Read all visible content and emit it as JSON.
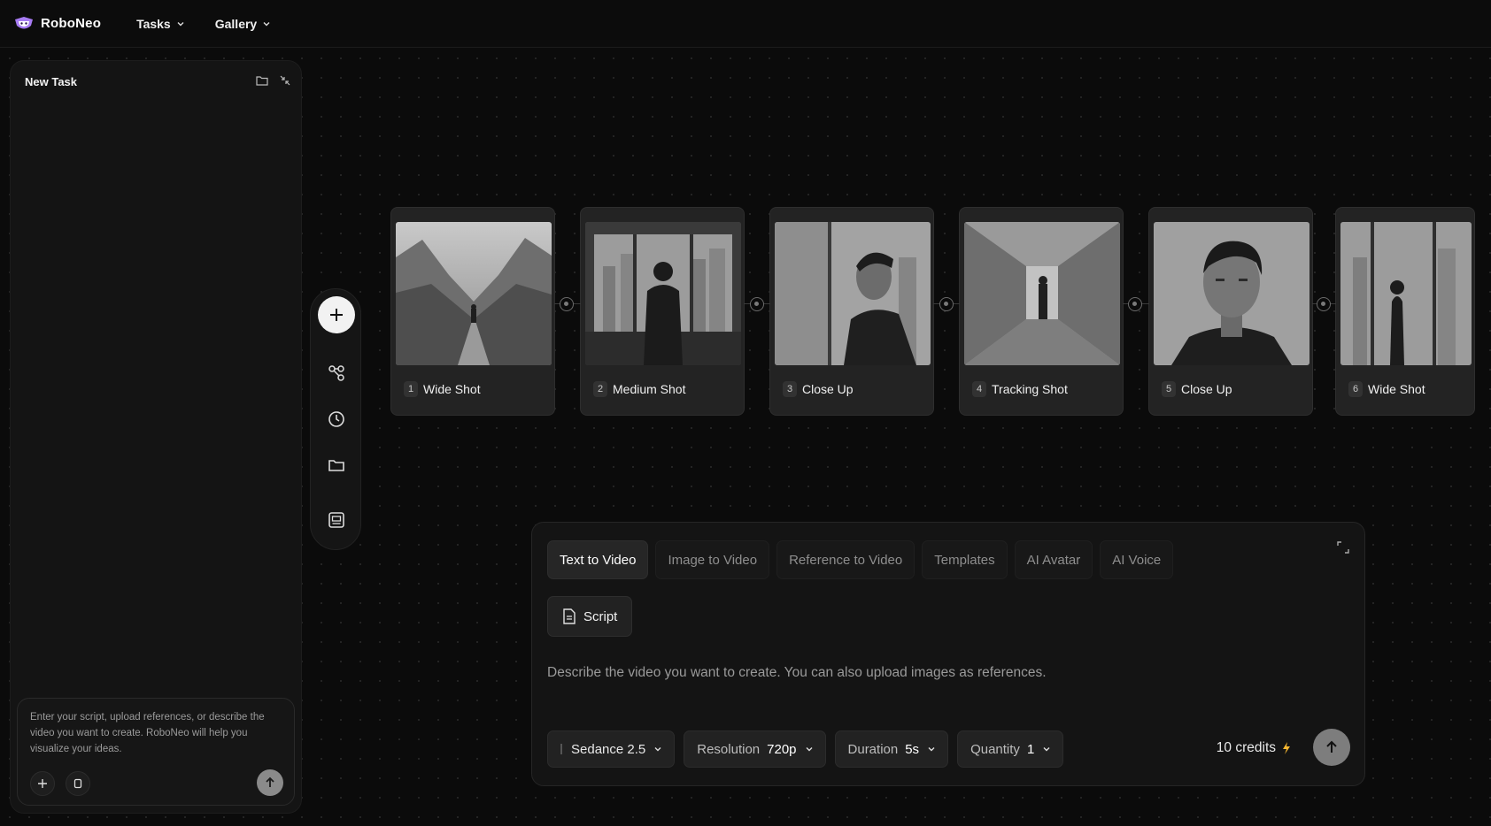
{
  "app": {
    "name": "RoboNeo"
  },
  "nav": {
    "tasks": "Tasks",
    "gallery": "Gallery"
  },
  "left_panel": {
    "title": "New Task",
    "chat_placeholder": "Enter your script, upload references, or describe the video you want to create. RoboNeo will help you visualize your ideas."
  },
  "shots": [
    {
      "num": "1",
      "label": "Wide Shot"
    },
    {
      "num": "2",
      "label": "Medium Shot"
    },
    {
      "num": "3",
      "label": "Close Up"
    },
    {
      "num": "4",
      "label": "Tracking Shot"
    },
    {
      "num": "5",
      "label": "Close Up"
    },
    {
      "num": "6",
      "label": "Wide Shot"
    }
  ],
  "composer": {
    "tabs": [
      "Text to Video",
      "Image to Video",
      "Reference to Video",
      "Templates",
      "AI Avatar",
      "AI Voice"
    ],
    "script_label": "Script",
    "prompt_placeholder": "Describe the video you want to create. You can also upload images as references.",
    "model": "Sedance 2.5",
    "resolution_label": "Resolution",
    "resolution_value": "720p",
    "duration_label": "Duration",
    "duration_value": "5s",
    "quantity_label": "Quantity",
    "quantity_value": "1",
    "credits": "10 credits"
  },
  "colors": {
    "accent_bolt": "#f5b731",
    "logo_purple": "#a77bf3"
  }
}
